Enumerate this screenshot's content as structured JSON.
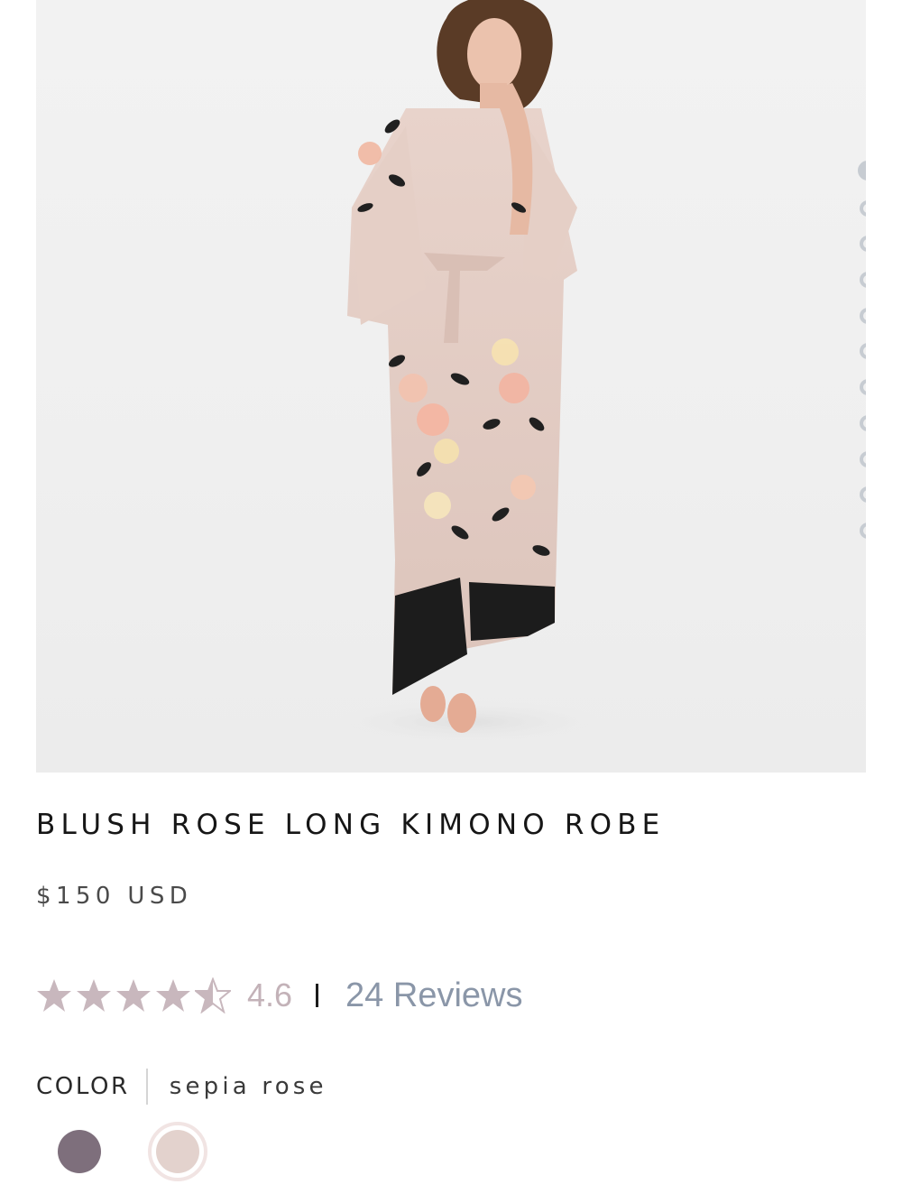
{
  "product": {
    "title": "BLUSH ROSE LONG KIMONO ROBE",
    "price": "$150 USD",
    "image_description_icon": "product-photo",
    "rating": {
      "value": "4.6",
      "stars_filled": 4.5,
      "stars_total": 5,
      "reviews_label": "24 Reviews"
    },
    "color": {
      "label": "COLOR",
      "selected": "sepia rose",
      "swatches": [
        {
          "color": "#7e6f7c",
          "selected": false
        },
        {
          "color": "#e3d2cd",
          "selected": true
        }
      ]
    }
  },
  "gallery": {
    "slide_count": 11,
    "active_index": 0
  },
  "colors": {
    "star": "#c8b7bd",
    "dot": "#c7ccd2",
    "reviews_link": "#8a96a8"
  }
}
